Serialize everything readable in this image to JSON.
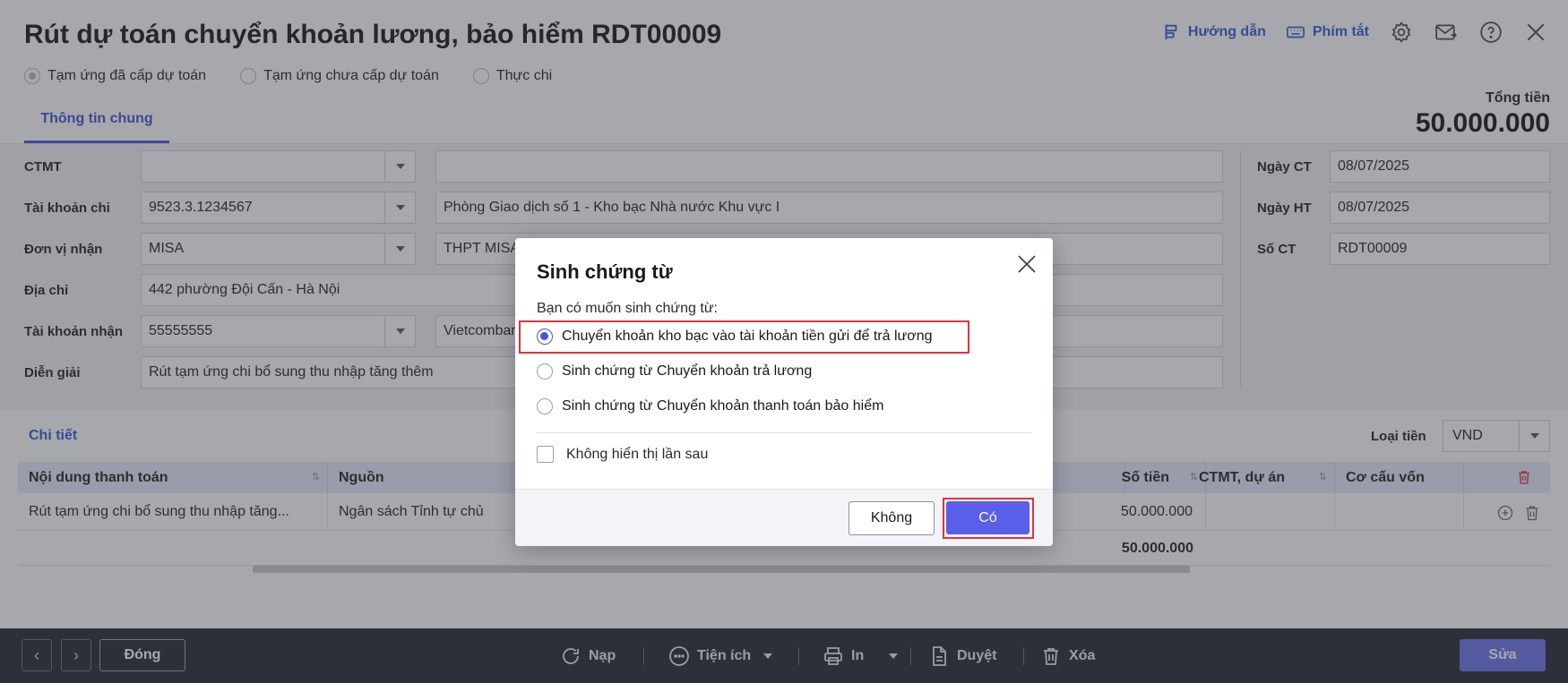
{
  "header": {
    "title": "Rút dự toán chuyển khoản lương, bảo hiểm RDT00009",
    "guide_label": "Hướng dẫn",
    "shortcut_label": "Phím tắt"
  },
  "modes": [
    "Tạm ứng đã cấp dự toán",
    "Tạm ứng chưa cấp dự toán",
    "Thực chi"
  ],
  "tab_label": "Thông tin chung",
  "total": {
    "label": "Tổng tiền",
    "value": "50.000.000"
  },
  "form": {
    "ctmt_label": "CTMT",
    "ctmt_value": "",
    "ctmt_desc": "",
    "account_label": "Tài khoản chi",
    "account_value": "9523.3.1234567",
    "account_desc": "Phòng Giao dịch số 1 - Kho bạc Nhà nước Khu vực I",
    "unit_label": "Đơn vị nhận",
    "unit_value": "MISA",
    "unit_desc": "THPT MISA",
    "address_label": "Địa chỉ",
    "address_value": "442 phường Đội Cấn - Hà Nội",
    "recv_label": "Tài khoản nhận",
    "recv_value": "55555555",
    "recv_desc": "Vietcomban",
    "note_label": "Diễn giải",
    "note_value": "Rút tạm ứng chi bổ sung thu nhập tăng thêm",
    "date_ct_label": "Ngày CT",
    "date_ct_value": "08/07/2025",
    "date_ht_label": "Ngày HT",
    "date_ht_value": "08/07/2025",
    "so_ct_label": "Số CT",
    "so_ct_value": "RDT00009"
  },
  "details": {
    "title": "Chi tiết",
    "currency_label": "Loại tiền",
    "currency_value": "VND",
    "columns": [
      "Nội dung thanh toán",
      "Nguồn",
      "Số tiền",
      "CTMT, dự án",
      "Cơ cấu vốn"
    ],
    "rows": [
      {
        "content": "Rút tạm ứng chi bổ sung thu nhập tăng...",
        "source": "Ngân sách Tỉnh tự chủ",
        "amount": "50.000.000",
        "ctmt": "",
        "capital": ""
      }
    ],
    "sum": "50.000.000"
  },
  "footer": {
    "close_label": "Đóng",
    "reload_label": "Nạp",
    "utility_label": "Tiện ích",
    "print_label": "In",
    "approve_label": "Duyệt",
    "delete_label": "Xóa",
    "edit_label": "Sửa"
  },
  "dialog": {
    "title": "Sinh chứng từ",
    "question": "Bạn có muốn sinh chứng từ:",
    "options": [
      "Chuyển khoản kho bạc vào tài khoản tiền gửi để trả lương",
      "Sinh chứng từ Chuyển khoản trả lương",
      "Sinh chứng từ Chuyển khoản thanh toán bảo hiểm"
    ],
    "selected_option": 0,
    "dont_show_label": "Không hiển thị lần sau",
    "no_label": "Không",
    "yes_label": "Có"
  },
  "colors": {
    "accent": "#5a5fe9",
    "highlight": "#e0333c",
    "link": "#2a5bd7"
  }
}
